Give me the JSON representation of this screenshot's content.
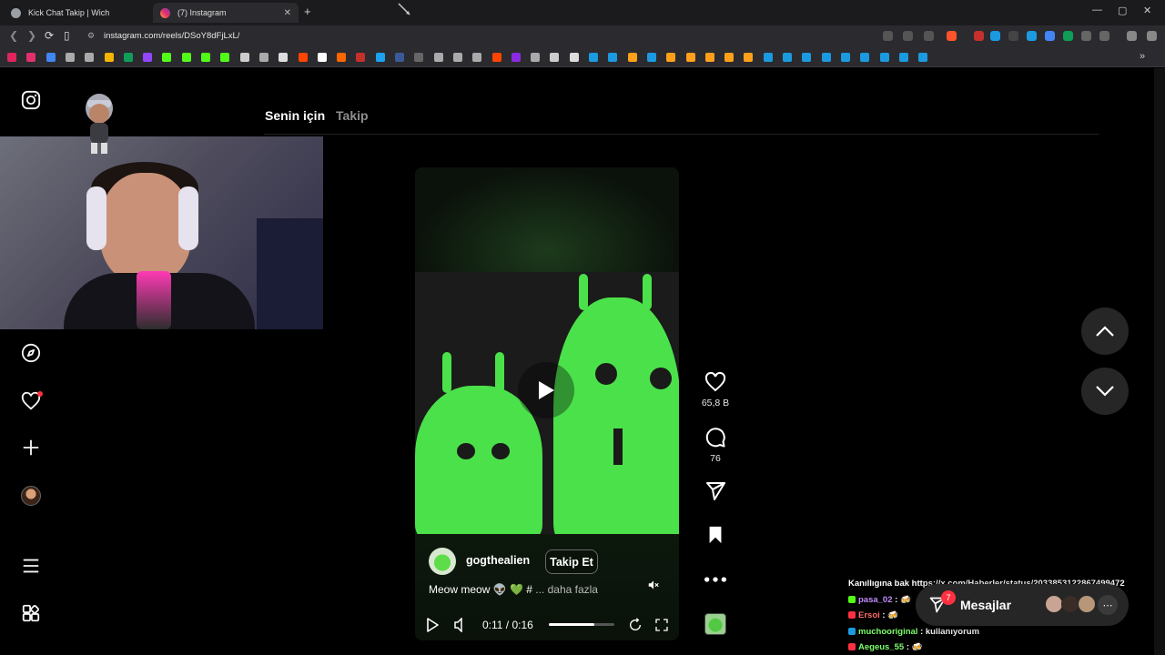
{
  "browser": {
    "tabs": [
      {
        "title": "Kick Chat Takip | Wich",
        "active": false,
        "favicon_color": "#9aa0a6"
      },
      {
        "title": "(7) Instagram",
        "active": true,
        "favicon_color": "#e1306c"
      }
    ],
    "new_tab_icon": "plus-icon",
    "window_controls": [
      "—",
      "▢",
      "✕"
    ],
    "url": "instagram.com/reels/DSoY8dFjLxL/",
    "bookmark_colors": [
      "#e0245e",
      "#e1306c",
      "#4285f4",
      "#aaa",
      "#aaa",
      "#f4b400",
      "#0f9d58",
      "#9146ff",
      "#53fc18",
      "#53fc18",
      "#53fc18",
      "#53fc18",
      "#ccc",
      "#aaa",
      "#ddd",
      "#ff4500",
      "#fff",
      "#ff6600",
      "#c4302b",
      "#1da1f2",
      "#3b5998",
      "#666",
      "#aaa",
      "#aaa",
      "#aaa",
      "#ff4500",
      "#8a2be2",
      "#aaa",
      "#ccc",
      "#ddd",
      "#1b9ae0",
      "#1b9ae0",
      "#ff9f1a",
      "#1b9ae0",
      "#ff9f1a",
      "#ff9f1a",
      "#ff9f1a",
      "#ff9f1a",
      "#ff9f1a",
      "#1b9ae0",
      "#1b9ae0",
      "#1b9ae0",
      "#1b9ae0",
      "#1b9ae0",
      "#1b9ae0",
      "#1b9ae0",
      "#1b9ae0",
      "#1b9ae0"
    ]
  },
  "sidebar": {
    "logo": "instagram-logo-icon",
    "items": [
      "explore-icon",
      "heart-icon",
      "create-icon",
      "profile-avatar"
    ],
    "bottom": [
      "menu-icon",
      "apps-icon"
    ]
  },
  "feed_tabs": {
    "active": "Senin için",
    "inactive": "Takip"
  },
  "reel": {
    "owner": "gogthealien",
    "follow_label": "Takip Et",
    "caption": "Meow meow 👽 💚 #",
    "caption_more": "... daha fazla",
    "time": "0:11 / 0:16",
    "progress": 0.69,
    "likes": "65,8 B",
    "comments": "76",
    "accent": "#4be14a"
  },
  "chat": {
    "lines": [
      {
        "user": "",
        "text": "Kanıllıgına bak https://x.com/Haberler/status/2033853122867499472",
        "color": "#ffffff"
      },
      {
        "user": "pasa_02",
        "text": ": 🍻",
        "color": "#c08cff",
        "badge": "#53fc18"
      },
      {
        "user": "Ersoi",
        "text": ": 🍻",
        "color": "#ff6b6b",
        "badge": "#ff3040"
      },
      {
        "user": "muchooriginal",
        "text": ": kullanıyorum",
        "color": "#7dff6b",
        "badge": "#1b9ae0"
      },
      {
        "user": "Aegeus_55",
        "text": ": 🍻",
        "color": "#7dff6b",
        "badge": "#ff3040"
      }
    ]
  },
  "messages": {
    "label": "Mesajlar",
    "count": "7"
  }
}
